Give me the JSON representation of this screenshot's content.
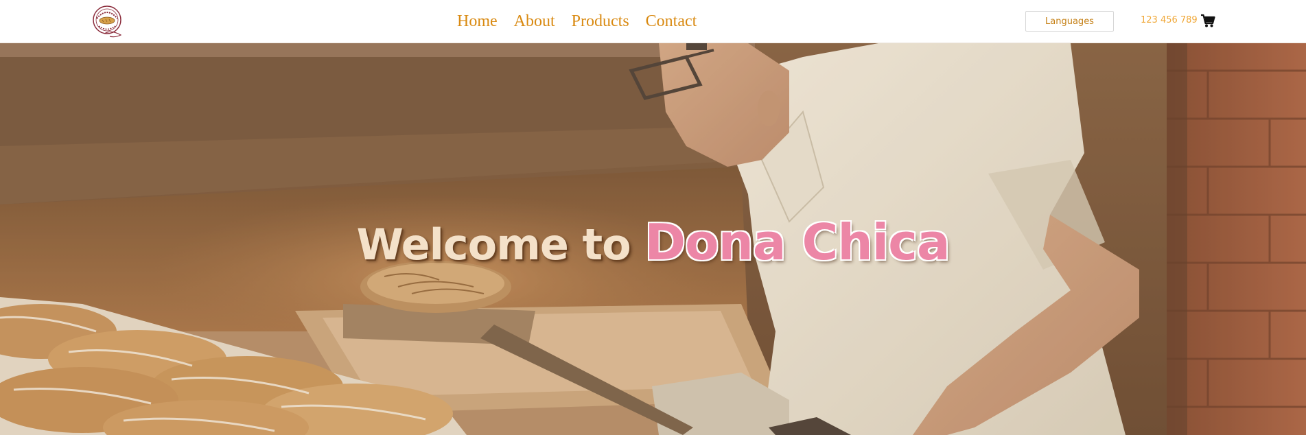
{
  "header": {
    "logo_icon": "bakery-logo-icon",
    "nav": [
      {
        "label": "Home"
      },
      {
        "label": "About"
      },
      {
        "label": "Products"
      },
      {
        "label": "Contact"
      }
    ],
    "languages_label": "Languages",
    "phone": "123 456 789",
    "cart_icon": "shopping-cart-icon"
  },
  "hero": {
    "title_prefix": "Welcome to",
    "title_brand": "Dona Chica",
    "image": "baker-placing-bread-in-oven-photo"
  },
  "colors": {
    "nav_text": "#d98a12",
    "phone_text": "#f0a736",
    "brand_pink": "#ec86a6",
    "cream": "#f4e1c9"
  }
}
